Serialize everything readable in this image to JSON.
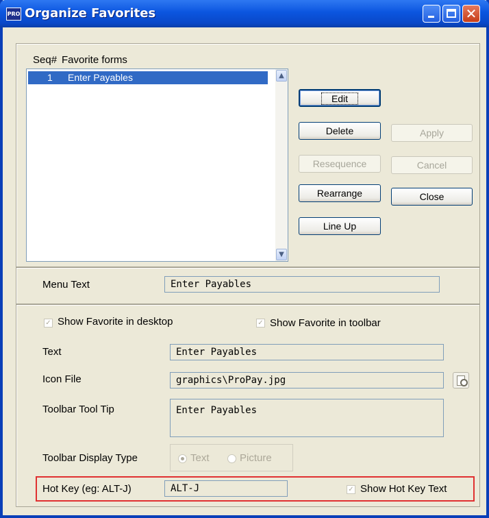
{
  "window": {
    "title": "Organize Favorites",
    "app_icon_text": "PRO"
  },
  "favorites": {
    "header_seq": "Seq#",
    "header_forms": "Favorite forms",
    "rows": [
      {
        "seq": "1",
        "name": "Enter Payables",
        "selected": true
      }
    ]
  },
  "buttons": {
    "edit": "Edit",
    "delete": "Delete",
    "apply": "Apply",
    "resequence": "Resequence",
    "cancel": "Cancel",
    "rearrange": "Rearrange",
    "close": "Close",
    "line_up": "Line Up"
  },
  "menu_text": {
    "label": "Menu Text",
    "value": "Enter Payables"
  },
  "options": {
    "show_desktop": {
      "label": "Show Favorite in desktop",
      "checked": true,
      "enabled": false
    },
    "show_toolbar": {
      "label": "Show Favorite in toolbar",
      "checked": true,
      "enabled": false
    },
    "text": {
      "label": "Text",
      "value": "Enter Payables"
    },
    "icon_file": {
      "label": "Icon File",
      "value": "graphics\\ProPay.jpg"
    },
    "tooltip": {
      "label": "Toolbar Tool Tip",
      "value": "Enter Payables"
    },
    "display_type": {
      "label": "Toolbar Display Type",
      "option_text": "Text",
      "option_picture": "Picture",
      "selected": "Text"
    },
    "hotkey": {
      "label": "Hot Key  (eg: ALT-J)",
      "value": "ALT-J",
      "show_label": "Show Hot Key Text",
      "show_checked": true
    }
  },
  "colors": {
    "title_bar": "#0b55df",
    "selection": "#316ac5",
    "highlight_border": "#e03030",
    "dialog_bg": "#ece9d8"
  }
}
